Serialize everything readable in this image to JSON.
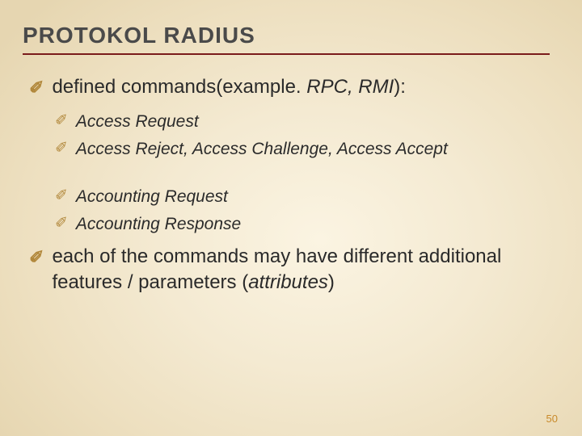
{
  "title": "PROTOKOL RADIUS",
  "l1a_pre": "defined commands(example. ",
  "l1a_it": "RPC, RMI",
  "l1a_post": "):",
  "l2a": "Access Request",
  "l2b": "Access Reject, Access Challenge, Access Accept",
  "l2c": "Accounting Request",
  "l2d": "Accounting Response",
  "l1b_pre": "each of the commands may have different additional features / parameters (",
  "l1b_it": "attributes",
  "l1b_post": ")",
  "page": "50",
  "bul1": "✐",
  "bul2": "✐"
}
